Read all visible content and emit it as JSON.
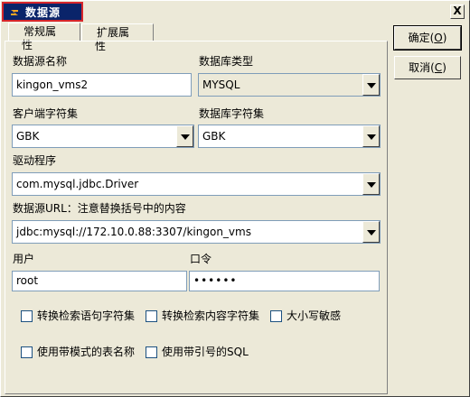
{
  "window": {
    "title": "数据源",
    "icon": "datasource-icon",
    "close_glyph": "X"
  },
  "tabs": [
    {
      "label": "常规属性",
      "active": true
    },
    {
      "label": "扩展属性",
      "active": false
    }
  ],
  "form": {
    "name_label": "数据源名称",
    "name_value": "kingon_vms2",
    "dbtype_label": "数据库类型",
    "dbtype_value": "MYSQL",
    "client_charset_label": "客户端字符集",
    "client_charset_value": "GBK",
    "db_charset_label": "数据库字符集",
    "db_charset_value": "GBK",
    "driver_label": "驱动程序",
    "driver_value": "com.mysql.jdbc.Driver",
    "url_label": "数据源URL：注意替换括号中的内容",
    "url_value": "jdbc:mysql://172.10.0.88:3307/kingon_vms",
    "user_label": "用户",
    "user_value": "root",
    "password_label": "口令",
    "password_value": "••••••"
  },
  "checkboxes": [
    {
      "label": "转换检索语句字符集",
      "checked": false
    },
    {
      "label": "转换检索内容字符集",
      "checked": false
    },
    {
      "label": "大小写敏感",
      "checked": false
    },
    {
      "label": "使用带模式的表名称",
      "checked": false
    },
    {
      "label": "使用带引号的SQL",
      "checked": false
    }
  ],
  "buttons": {
    "ok_label": "确定(",
    "ok_mnemonic": "O",
    "ok_suffix": ")",
    "cancel_label": "取消(",
    "cancel_mnemonic": "C",
    "cancel_suffix": ")"
  },
  "colors": {
    "title_active": "#0a246a",
    "focus_outline": "#d8262b",
    "dialog_bg": "#ece9d8",
    "field_border": "#7f9db9"
  }
}
